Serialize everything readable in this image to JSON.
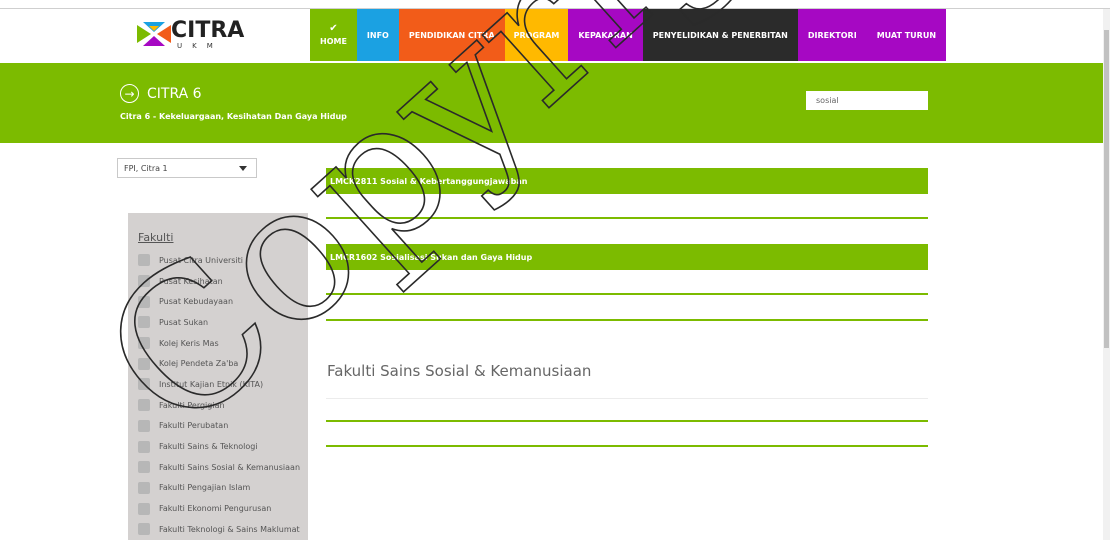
{
  "logo": {
    "text": "CITRA",
    "sub": "UKM"
  },
  "nav": {
    "items": [
      {
        "label": "HOME",
        "color": "#7cbb00",
        "active": true,
        "check": "✔"
      },
      {
        "label": "INFO",
        "color": "#1ba1e2"
      },
      {
        "label": "PENDIDIKAN CITRA",
        "color": "#f25c19"
      },
      {
        "label": "PROGRAM",
        "color": "#ffb900"
      },
      {
        "label": "KEPAKARAN",
        "color": "#a608c3"
      },
      {
        "label": "PENYELIDIKAN & PENERBITAN",
        "color": "#2b2b2b"
      },
      {
        "label": "DIREKTORI",
        "color": "#a608c3"
      },
      {
        "label": "MUAT TURUN",
        "color": "#a608c3"
      }
    ]
  },
  "band": {
    "title": "CITRA 6",
    "subtitle": "Citra 6 - Kekeluargaan, Kesihatan Dan Gaya Hidup",
    "arrow_icon": "arrow-right-circle-icon",
    "bg": "#7cbb00"
  },
  "search": {
    "value": "sosial"
  },
  "filter": {
    "selected": "FPI, Citra 1"
  },
  "sidebar": {
    "title": "Fakulti",
    "items": [
      "Pusat Citra Universiti",
      "Pusat Kesihatan",
      "Pusat Kebudayaan",
      "Pusat Sukan",
      "Kolej Keris Mas",
      "Kolej Pendeta Za'ba",
      "Institut Kajian Etnik (KITA)",
      "Fakulti Pergigian",
      "Fakulti Perubatan",
      "Fakulti Sains & Teknologi",
      "Fakulti Sains Sosial & Kemanusiaan",
      "Fakulti Pengajian Islam",
      "Fakulti Ekonomi Pengurusan",
      "Fakulti Teknologi & Sains Maklumat"
    ]
  },
  "courses": [
    {
      "title": "LMCK2811 Sosial & Kebertanggungjawaban"
    },
    {
      "title": "LMCR1602 Sosialisasi Sukan dan Gaya Hidup"
    }
  ],
  "section": {
    "title": "Fakulti Sains Sosial & Kemanusiaan"
  },
  "watermark": {
    "text": "Copyright"
  }
}
